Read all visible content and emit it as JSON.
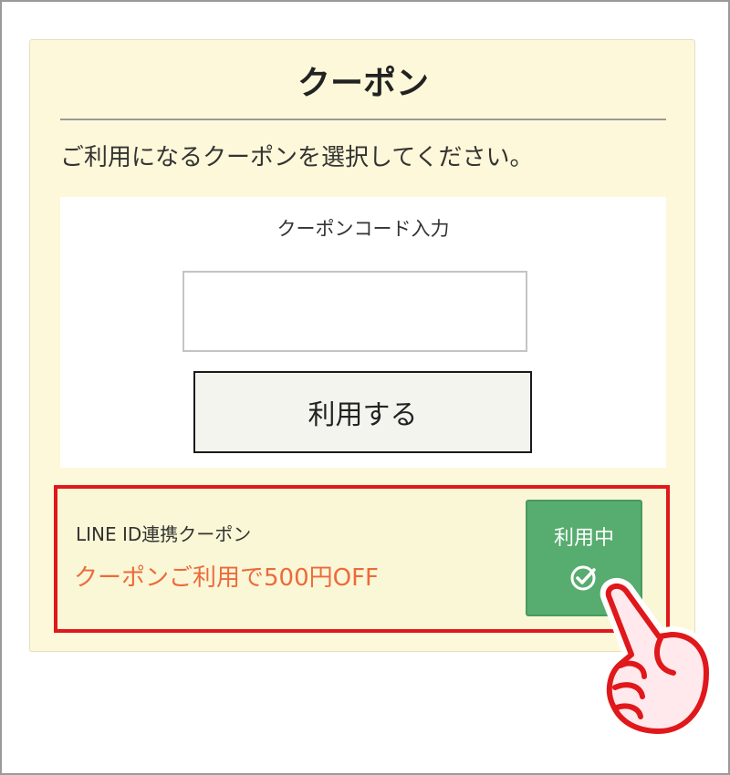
{
  "coupon_page": {
    "title": "クーポン",
    "instruction": "ご利用になるクーポンを選択してください。",
    "code_entry": {
      "label": "クーポンコード入力",
      "input_value": "",
      "apply_button_label": "利用する"
    },
    "coupon": {
      "name": "LINE ID連携クーポン",
      "description": "クーポンご利用で500円OFF",
      "status_button_label": "利用中",
      "status_icon": "check-circle-icon"
    }
  },
  "annotations": {
    "highlight_color": "#e0181b",
    "pointer_icon": "pointing-hand-icon"
  },
  "colors": {
    "card_background": "#fdf8d9",
    "in_use_green": "#57ad6f",
    "discount_text": "#ec6a3c"
  }
}
